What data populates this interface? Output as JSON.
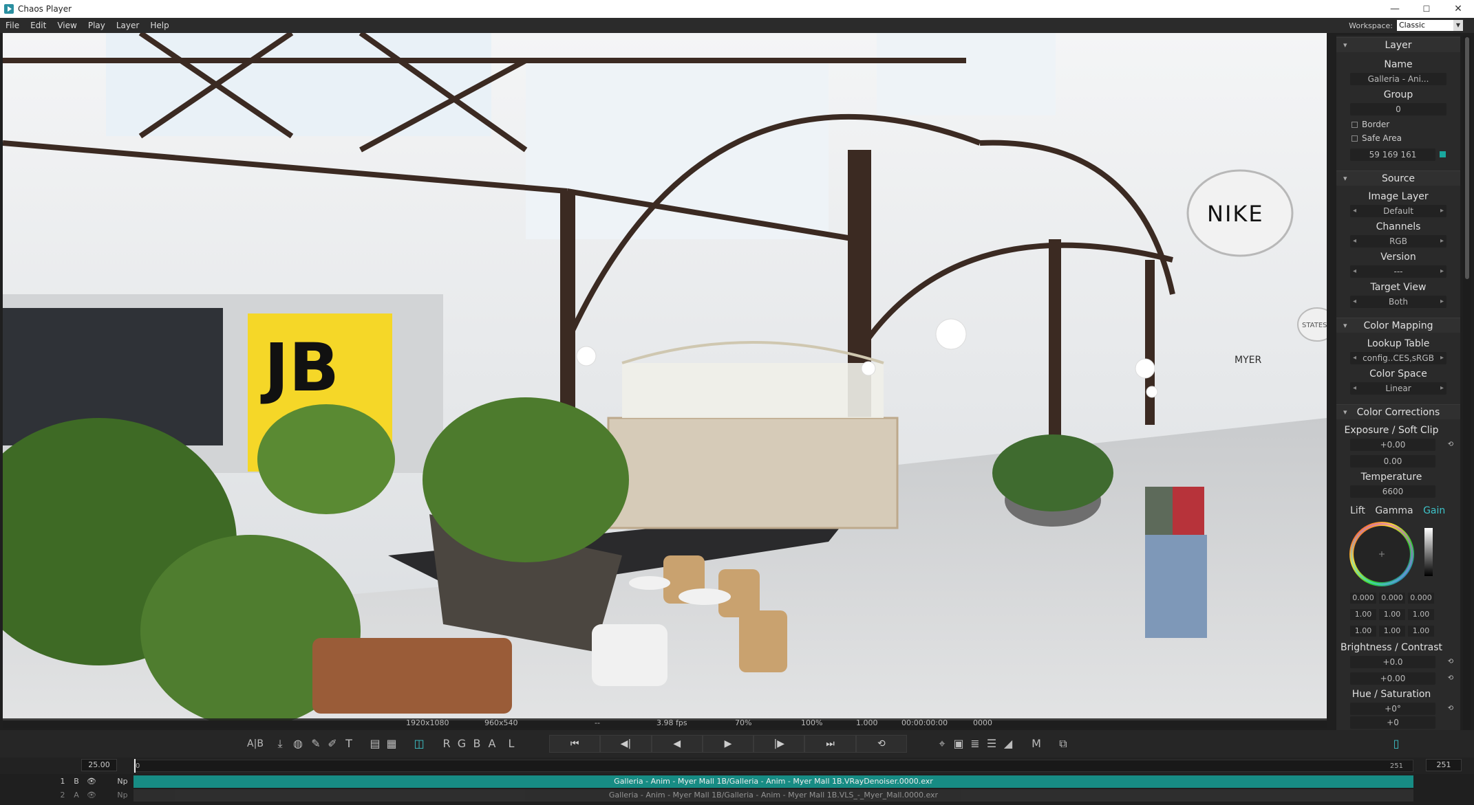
{
  "window": {
    "title": "Chaos Player",
    "min": "—",
    "max": "☐",
    "close": "✕"
  },
  "menu": [
    "File",
    "Edit",
    "View",
    "Play",
    "Layer",
    "Help"
  ],
  "workspace": {
    "label": "Workspace:",
    "value": "Classic"
  },
  "viewport": {
    "signs": {
      "nike": "NIKE",
      "jb": "JB",
      "states": "STATES",
      "myer": "MYER"
    }
  },
  "status": {
    "resolution": "1920x1080",
    "proxy": "960x540",
    "cursor": "--",
    "fps": "3.98 fps",
    "zoom_pct": "70%",
    "scale": "100%",
    "ratio": "1.000",
    "timecode": "00:00:00:00",
    "frame": "0000"
  },
  "toolbar": {
    "ab": "A|B",
    "channels": [
      "R",
      "G",
      "B",
      "A",
      "L"
    ],
    "transport": [
      "⏮",
      "◀|",
      "◀",
      "▶",
      "|▶",
      "⏭",
      "⟲"
    ],
    "m": "M"
  },
  "timeline": {
    "fps": "25.00",
    "start": "0",
    "end_marker": "251",
    "end": "251"
  },
  "layers": [
    {
      "index": "1",
      "ab": "B",
      "np": "Np",
      "name": "Galleria - Anim - Myer Mall 1B/Galleria - Anim - Myer Mall 1B.VRayDenoiser.0000.exr",
      "active": true
    },
    {
      "index": "2",
      "ab": "A",
      "np": "Np",
      "name": "Galleria - Anim - Myer Mall 1B/Galleria - Anim - Myer Mall 1B.VLS_-_Myer_Mall.0000.exr",
      "active": false
    }
  ],
  "panel": {
    "layer": {
      "header": "Layer",
      "name_label": "Name",
      "name_value": "Galleria - Ani...",
      "group_label": "Group",
      "group_value": "0",
      "border": "Border",
      "safe_area": "Safe Area",
      "color_value": "59 169 161",
      "swatch_color": "#1aa89e"
    },
    "source": {
      "header": "Source",
      "image_layer_label": "Image Layer",
      "image_layer_value": "Default",
      "channels_label": "Channels",
      "channels_value": "RGB",
      "version_label": "Version",
      "version_value": "---",
      "target_view_label": "Target View",
      "target_view_value": "Both"
    },
    "color_mapping": {
      "header": "Color Mapping",
      "lut_label": "Lookup Table",
      "lut_value": "config..CES,sRGB",
      "space_label": "Color Space",
      "space_value": "Linear"
    },
    "color_corrections": {
      "header": "Color Corrections",
      "exposure_label": "Exposure / Soft Clip",
      "exposure_value": "+0.00",
      "softclip_value": "0.00",
      "temperature_label": "Temperature",
      "temperature_value": "6600",
      "lift": "Lift",
      "gamma": "Gamma",
      "gain": "Gain",
      "rows": [
        [
          "0.000",
          "0.000",
          "0.000"
        ],
        [
          "1.00",
          "1.00",
          "1.00"
        ],
        [
          "1.00",
          "1.00",
          "1.00"
        ]
      ],
      "brightness_label": "Brightness / Contrast",
      "brightness_value": "+0.0",
      "contrast_value": "+0.00",
      "hue_label": "Hue / Saturation",
      "hue_value": "+0°",
      "saturation_value": "+0"
    }
  },
  "colors": {
    "accent": "#1a9e94",
    "gain": "#3ec2c8",
    "panel": "#2a2a2a"
  }
}
